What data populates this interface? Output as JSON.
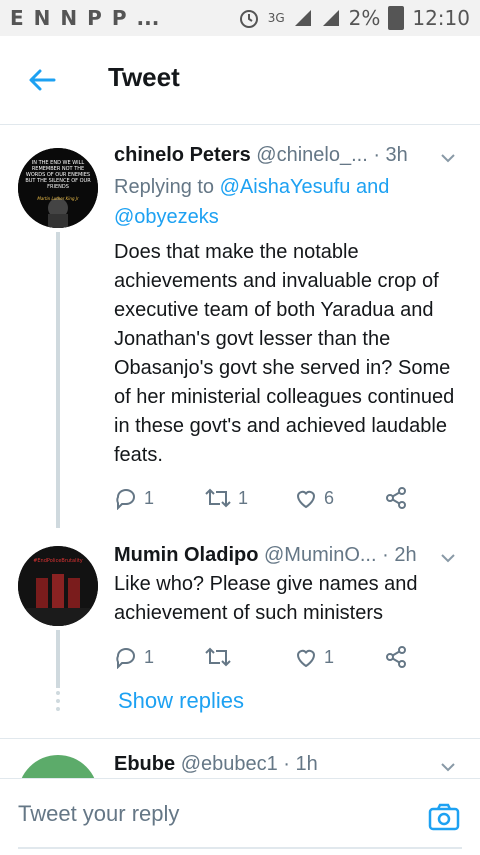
{
  "status_bar": {
    "time": "12:10",
    "battery": "2%",
    "network": "3G",
    "icons_left": [
      "E",
      "N",
      "N",
      "P",
      "P",
      "..."
    ]
  },
  "header": {
    "title": "Tweet"
  },
  "tweets": [
    {
      "name": "chinelo Peters",
      "handle": "@chinelo_...",
      "time": "· 3h",
      "replying_prefix": "Replying to",
      "replying_to_1": "@AishaYesufu and",
      "replying_to_2": "@obyezeks",
      "text": "Does that make the notable achievements and invaluable crop of executive  team  of both Yaradua and Jonathan's govt lesser than the Obasanjo's govt she served in? Some of her ministerial colleagues continued in these govt's and achieved laudable feats.",
      "replies": "1",
      "retweets": "1",
      "likes": "6",
      "avatar_text": "IN THE END WE WILL REMEMBER NOT THE WORDS OF OUR ENEMIES BUT THE SILENCE OF OUR FRIENDS",
      "avatar_signature": "Martin Luther King Jr"
    },
    {
      "name": "Mumin Oladipo",
      "handle": "@MuminO...",
      "time": "· 2h",
      "text": "Like who? Please give names and achievement of such ministers",
      "replies": "1",
      "retweets": "",
      "likes": "1",
      "avatar_text": "#EndPoliceBrutality"
    },
    {
      "name": "Ebube",
      "handle": "@ebubec1",
      "time": "· 1h"
    }
  ],
  "show_replies_label": "Show replies",
  "composer": {
    "placeholder": "Tweet your reply"
  },
  "colors": {
    "accent": "#1da1f2",
    "muted": "#657786",
    "divider": "#e1e8ed"
  }
}
